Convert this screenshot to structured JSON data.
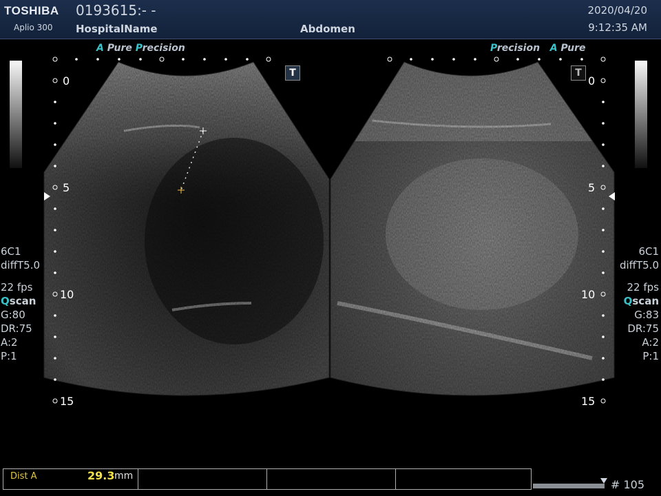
{
  "header": {
    "brand": "TOSHIBA",
    "model": "Aplio 300",
    "patient_id": "0193615:- -",
    "hospital": "HospitalName",
    "region": "Abdomen",
    "date": "2020/04/20",
    "time": "9:12:35 AM"
  },
  "left_image": {
    "tag_prefix": "A",
    "tag_mid": "Pure",
    "tag_p": "P",
    "tag_rest": "recision",
    "t_icon": "T",
    "depth_labels": [
      "0",
      "5",
      "10",
      "15"
    ],
    "params": {
      "probe": "6C1",
      "mode": "diffT5.0",
      "fps": "22 fps",
      "qscan_q": "Q",
      "qscan_rest": "scan",
      "gain": "G:80",
      "dr": "DR:75",
      "a": "A:2",
      "p": "P:1"
    }
  },
  "right_image": {
    "tag_p": "P",
    "tag_rest": "recision",
    "tag_prefix": "A",
    "tag_mid": "Pure",
    "t_icon": "T",
    "depth_labels": [
      "0",
      "5",
      "10",
      "15"
    ],
    "params": {
      "probe": "6C1",
      "mode": "diffT5.0",
      "fps": "22 fps",
      "qscan_q": "Q",
      "qscan_rest": "scan",
      "gain": "G:83",
      "dr": "DR:75",
      "a": "A:2",
      "p": "P:1"
    }
  },
  "measurement": {
    "label": "Dist A",
    "value": "29.3",
    "unit": "mm"
  },
  "footer": {
    "frame": "# 105"
  },
  "colors": {
    "accent": "#39c2c9",
    "measure": "#f4e04a",
    "header_bg": "#1c2e4c"
  }
}
